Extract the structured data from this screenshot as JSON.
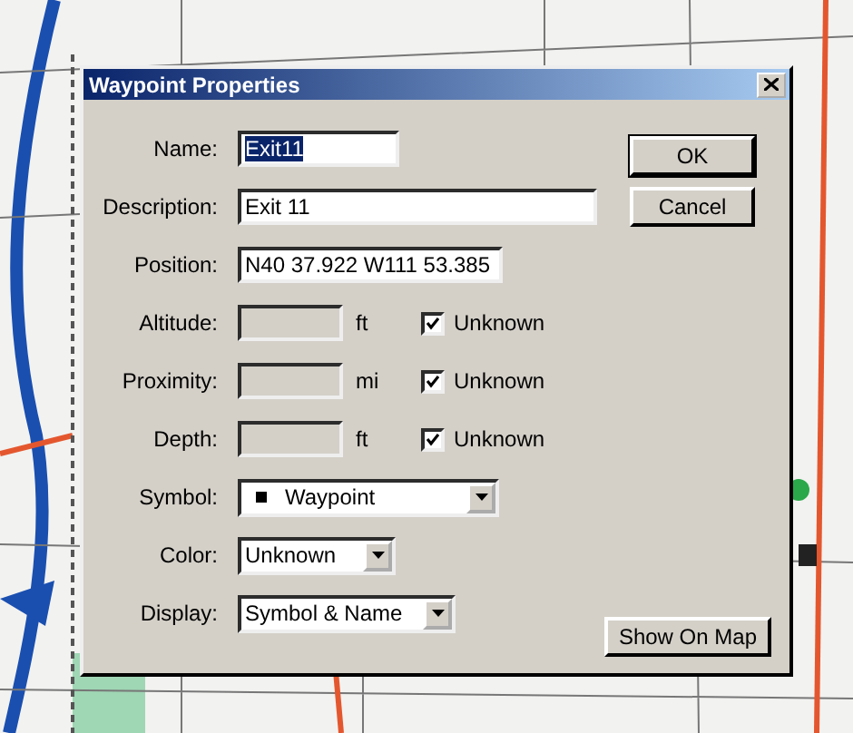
{
  "window": {
    "title": "Waypoint Properties"
  },
  "fields": [
    {
      "kind": "text",
      "label": "Name:",
      "value": "Exit11",
      "text_selected": true
    },
    {
      "kind": "text",
      "label": "Description:",
      "value": "Exit 11",
      "text_selected": false
    },
    {
      "kind": "text",
      "label": "Position:",
      "value": "N40 37.922 W111 53.385",
      "text_selected": false
    },
    {
      "kind": "measure",
      "label": "Altitude:",
      "unit": "ft",
      "disabled": true,
      "checkbox_label": "Unknown",
      "checked": true
    },
    {
      "kind": "measure",
      "label": "Proximity:",
      "unit": "mi",
      "disabled": true,
      "checkbox_label": "Unknown",
      "checked": true
    },
    {
      "kind": "measure",
      "label": "Depth:",
      "unit": "ft",
      "disabled": true,
      "checkbox_label": "Unknown",
      "checked": true
    },
    {
      "kind": "select",
      "label": "Symbol:",
      "value": "Waypoint",
      "symbol": true
    },
    {
      "kind": "select",
      "label": "Color:",
      "value": "Unknown",
      "symbol": false
    },
    {
      "kind": "select",
      "label": "Display:",
      "value": "Symbol & Name",
      "symbol": false
    }
  ],
  "buttons": [
    {
      "label": "OK",
      "default": true
    },
    {
      "label": "Cancel",
      "default": false
    }
  ],
  "show_on_map_button": {
    "label": "Show On Map"
  }
}
